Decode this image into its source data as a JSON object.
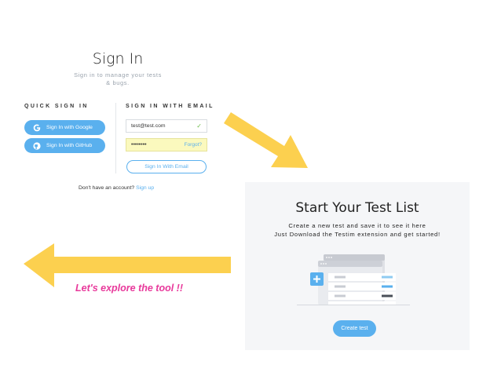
{
  "signin": {
    "title": "Sign In",
    "subtitle": "Sign in to manage your tests & bugs.",
    "quick_label": "QUICK SIGN IN",
    "email_label": "SIGN IN WITH EMAIL",
    "google_label": "Sign In with Google",
    "github_label": "Sign In with GitHub",
    "email_value": "test@test.com",
    "password_value": "••••••••",
    "forgot_label": "Forgot?",
    "submit_label": "Sign In With Email",
    "no_account_text": "Don't have an account?",
    "signup_label": "Sign up"
  },
  "testlist": {
    "title": "Start Your Test List",
    "line1": "Create a new test and save it to see it here",
    "line2": "Just Download the Testim extension and get started!",
    "create_label": "Create test"
  },
  "annotation": {
    "text": "Let's explore the tool !!"
  },
  "colors": {
    "accent": "#5ab0ee",
    "arrow": "#fcd04f",
    "annotation": "#e8399b",
    "password_bg": "#fbf9be"
  }
}
